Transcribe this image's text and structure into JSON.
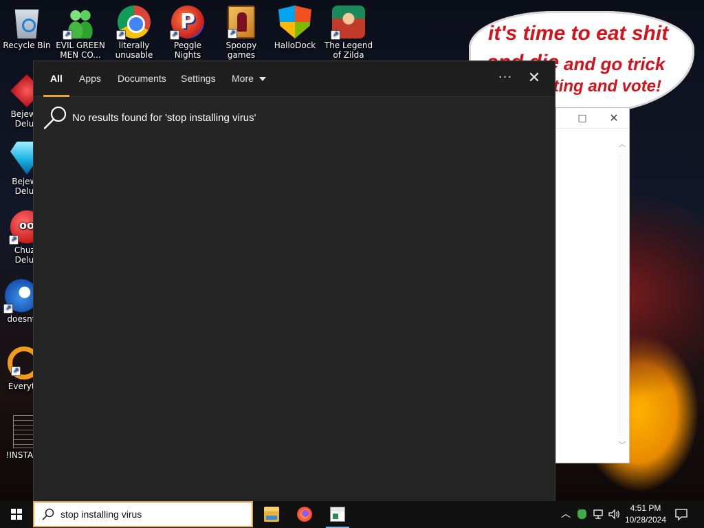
{
  "desktop": {
    "top_icons": [
      {
        "name": "recycle-bin",
        "caption": "Recycle Bin"
      },
      {
        "name": "evil-green-men",
        "caption": "EVIL GREEN MEN CO..."
      },
      {
        "name": "literally-unusable",
        "caption": "literally unusable"
      },
      {
        "name": "peggle-nights",
        "caption": "Peggle Nights Deluxe"
      },
      {
        "name": "spoopy-games",
        "caption": "Spoopy games"
      },
      {
        "name": "hallodock",
        "caption": "HalloDock"
      },
      {
        "name": "legend-of-zilda",
        "caption": "The Legend of Zilda"
      }
    ],
    "left_icons": [
      {
        "name": "bejeweled-1",
        "caption": "Bejewel Delux"
      },
      {
        "name": "bejeweled-2",
        "caption": "Bejewe Delux"
      },
      {
        "name": "chuzzle",
        "caption": "Chuzz Delux"
      },
      {
        "name": "doesnt",
        "caption": "doesnt"
      },
      {
        "name": "everything",
        "caption": "Everyth"
      },
      {
        "name": "install-doc",
        "caption": "!INSTALL"
      }
    ]
  },
  "wallpaper_bubble": {
    "line1": "it's time to eat shit",
    "line2": "and die",
    "line3": "and go trick",
    "line4": "or treating and vote!"
  },
  "bg_window": {
    "maximize_glyph": "□",
    "close_glyph": "✕"
  },
  "search_panel": {
    "tabs": [
      {
        "label": "All",
        "active": true
      },
      {
        "label": "Apps",
        "active": false
      },
      {
        "label": "Documents",
        "active": false
      },
      {
        "label": "Settings",
        "active": false
      },
      {
        "label": "More",
        "active": false
      }
    ],
    "more_options_glyph": "···",
    "close_glyph": "✕",
    "result_message": "No results found for 'stop installing virus'",
    "accent_color": "#e8a33a"
  },
  "taskbar": {
    "search_value": "stop installing virus",
    "pinned": [
      "file-explorer-icon",
      "firefox-icon",
      "app-window-icon"
    ],
    "tray_chevron": "^",
    "clock_time": "4:51 PM",
    "clock_date": "10/28/2024"
  }
}
